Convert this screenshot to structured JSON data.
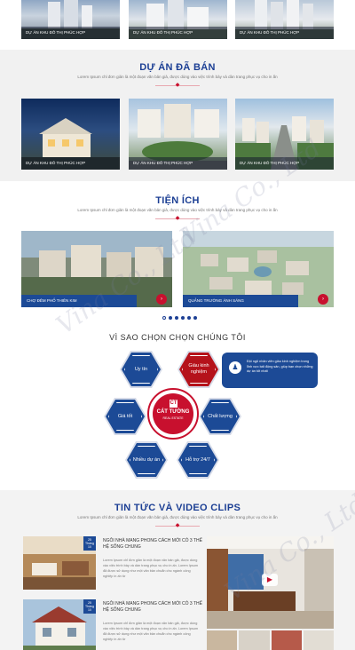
{
  "top_projects": {
    "cards": [
      {
        "caption": "DỰ ÁN KHU ĐÔ THỊ PHÚC HỢP"
      },
      {
        "caption": "DỰ ÁN KHU ĐÔ THỊ PHÚC HỢP"
      },
      {
        "caption": "DỰ ÁN KHU ĐÔ THỊ PHÚC HỢP"
      }
    ]
  },
  "sold_projects": {
    "title": "DỰ ÁN ĐÃ BÁN",
    "subtitle": "Lorem Ipsum chỉ đơn giản là một đoạn văn bản giả, được dùng vào việc trình bày và dàn trang phục vụ cho in ấn",
    "cards": [
      {
        "caption": "DỰ ÁN KHU ĐÔ THỊ PHÚC HỢP"
      },
      {
        "caption": "DỰ ÁN KHU ĐÔ THỊ PHÚC HỢP"
      },
      {
        "caption": "DỰ ÁN KHU ĐÔ THỊ PHÚC HỢP"
      }
    ]
  },
  "utilities": {
    "title": "TIỆN ÍCH",
    "subtitle": "Lorem Ipsum chỉ đơn giản là một đoạn văn bản giả, được dùng vào việc trình bày và dàn trang phục vụ cho in ấn",
    "items": [
      {
        "caption": "CHỢ ĐÊM PHỐ THIÊN KIM",
        "button": "›"
      },
      {
        "caption": "QUẢNG TRƯỜNG ÁNH SÁNG",
        "button": "›"
      }
    ],
    "dots_count": 6,
    "active_dot": 0
  },
  "why_us": {
    "title": "VÌ SAO CHỌN CHỌN CHÚNG TÔI",
    "items": [
      {
        "label": "Uy tín"
      },
      {
        "label": "Giàu kinh nghiệm"
      },
      {
        "label": "Giá tốt"
      },
      {
        "label": "Chất lượng"
      },
      {
        "label": "Nhiều dự án"
      },
      {
        "label": "Hỗ trợ 24/7"
      }
    ],
    "center": {
      "brand": "CÁT TƯỜNG",
      "sub": "REAL ESTATE",
      "icon": "CT"
    },
    "tooltip": "Đội ngũ nhân viên giàu kinh nghiệm trong lĩnh vực bất động sản, giúp bạn chọn những dự án tốt nhất"
  },
  "news": {
    "title": "TIN TỨC VÀ VIDEO CLIPS",
    "subtitle": "Lorem Ipsum chỉ đơn giản là một đoạn văn bản giả, được dùng vào việc trình bày và dàn trang phục vụ cho in ấn",
    "articles": [
      {
        "day": "25",
        "month": "Tháng 10",
        "headline": "NGÔI NHÀ MANG PHONG CÁCH MỚI CÓ 3 THẾ HỆ SỐNG CHUNG",
        "excerpt": "Lorem Ipsum chỉ đơn giản là một đoạn văn bản giả, được dùng vào việc trình bày và dàn trang phục vụ cho in ấn. Lorem Ipsum đã được sử dụng như một văn bản chuẩn cho ngành công nghiệp in ấn từ"
      },
      {
        "day": "25",
        "month": "Tháng 10",
        "headline": "NGÔI NHÀ MANG PHONG CÁCH MỚI CÓ 3 THẾ HỆ SỐNG CHUNG",
        "excerpt": "Lorem Ipsum chỉ đơn giản là một đoạn văn bản giả, được dùng vào việc trình bày và dàn trang phục vụ cho in ấn. Lorem Ipsum đã được sử dụng như một văn bản chuẩn cho ngành công nghiệp in ấn từ"
      }
    ],
    "play_icon": "▶"
  },
  "watermark": "Vina Co., Ltd",
  "colors": {
    "brand_blue": "#1c3f94",
    "brand_red": "#c8102e"
  }
}
